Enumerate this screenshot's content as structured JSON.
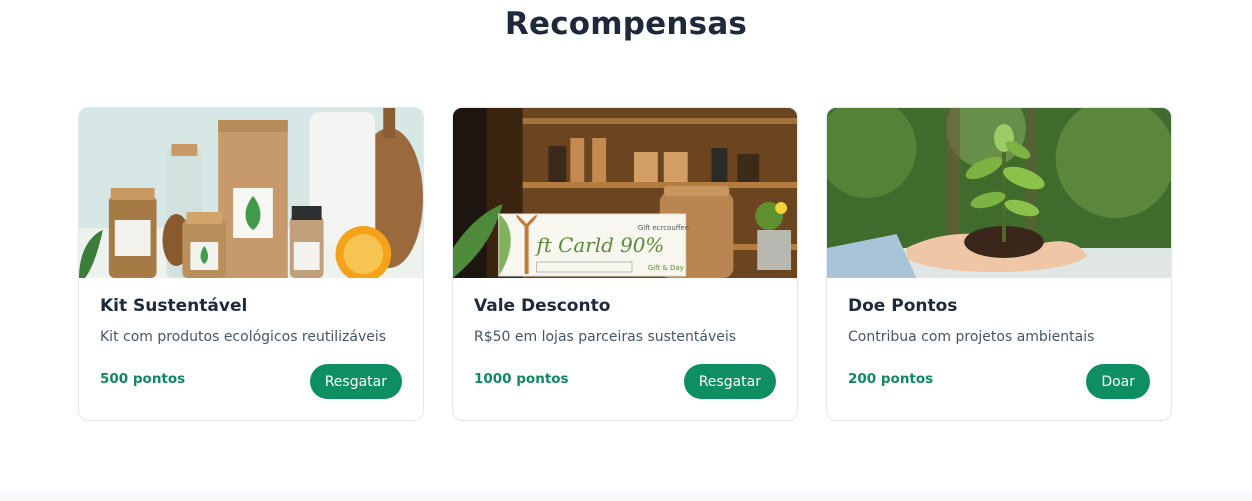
{
  "section": {
    "title": "Recompensas"
  },
  "rewards": [
    {
      "title": "Kit Sustentável",
      "description": "Kit com produtos ecológicos reutilizáveis",
      "points": "500 pontos",
      "button_label": "Resgatar",
      "image": "eco-kit-products-image"
    },
    {
      "title": "Vale Desconto",
      "description": "R$50 em lojas parceiras sustentáveis",
      "points": "1000 pontos",
      "button_label": "Resgatar",
      "image": "gift-card-shop-image",
      "image_text": {
        "card": "ft Carld 90%",
        "brand": "Gift ecrcouffee",
        "small": "Gift & Day"
      }
    },
    {
      "title": "Doe Pontos",
      "description": "Contribua com projetos ambientais",
      "points": "200 pontos",
      "button_label": "Doar",
      "image": "hands-plant-seedling-image"
    }
  ],
  "colors": {
    "accent": "#0e8f62",
    "points_text": "#0e8a5f",
    "title_text": "#1e293b"
  }
}
